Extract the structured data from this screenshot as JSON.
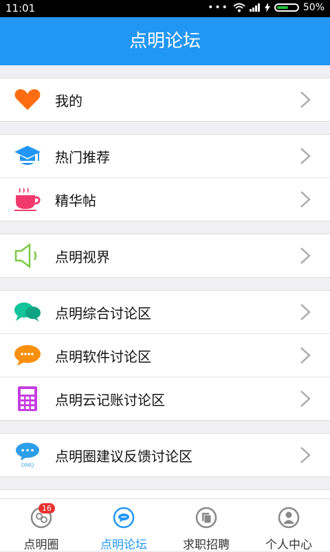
{
  "status": {
    "time": "11:01",
    "battery": "50%"
  },
  "header": {
    "title": "点明论坛"
  },
  "groups": [
    {
      "items": [
        {
          "label": "我的",
          "icon": "heart-icon"
        }
      ]
    },
    {
      "items": [
        {
          "label": "热门推荐",
          "icon": "graduation-cap-icon"
        },
        {
          "label": "精华帖",
          "icon": "coffee-cup-icon"
        }
      ]
    },
    {
      "items": [
        {
          "label": "点明视界",
          "icon": "speaker-icon"
        }
      ]
    },
    {
      "items": [
        {
          "label": "点明综合讨论区",
          "icon": "chat-bubbles-icon"
        },
        {
          "label": "点明软件讨论区",
          "icon": "message-dots-icon"
        },
        {
          "label": "点明云记账讨论区",
          "icon": "calculator-icon"
        }
      ]
    },
    {
      "items": [
        {
          "label": "点明圈建议反馈讨论区",
          "icon": "dmq-bubble-icon",
          "icon_text": "DMQ"
        }
      ]
    }
  ],
  "tabs": [
    {
      "label": "点明圈",
      "badge": "16",
      "active": false
    },
    {
      "label": "点明论坛",
      "active": true
    },
    {
      "label": "求职招聘",
      "active": false
    },
    {
      "label": "个人中心",
      "active": false
    }
  ],
  "colors": {
    "accent": "#2196f3",
    "badge": "#e8312f"
  }
}
